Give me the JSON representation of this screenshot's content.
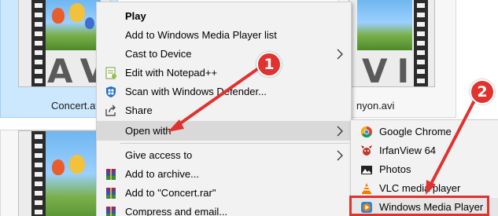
{
  "explorer": {
    "files": [
      {
        "name": "Concert.avi",
        "ext": "AVI"
      },
      {
        "name": "Canyon.avi",
        "name_visible": "nyon.avi",
        "ext": "VI"
      }
    ],
    "lower_tiles": 2
  },
  "context_menu": {
    "items": [
      {
        "label": "Play",
        "bold": true,
        "icon": null
      },
      {
        "label": "Add to Windows Media Player list",
        "icon": null
      },
      {
        "label": "Cast to Device",
        "icon": null,
        "submenu": true
      },
      {
        "label": "Edit with Notepad++",
        "icon": "notepad-plus-plus-icon"
      },
      {
        "label": "Scan with Windows Defender...",
        "icon": "windows-defender-shield-icon"
      },
      {
        "label": "Share",
        "icon": "share-icon"
      },
      {
        "label": "Open with",
        "icon": null,
        "submenu": true,
        "highlighted": true
      },
      {
        "label": "Give access to",
        "icon": null,
        "submenu": true
      },
      {
        "label": "Add to archive...",
        "icon": "winrar-icon"
      },
      {
        "label": "Add to \"Concert.rar\"",
        "icon": "winrar-icon"
      },
      {
        "label": "Compress and email...",
        "icon": "winrar-icon"
      }
    ]
  },
  "open_with_submenu": {
    "items": [
      {
        "label": "Google Chrome",
        "icon": "chrome-icon"
      },
      {
        "label": "IrfanView 64",
        "icon": "irfanview-icon"
      },
      {
        "label": "Photos",
        "icon": "photos-icon"
      },
      {
        "label": "VLC media player",
        "icon": "vlc-icon"
      },
      {
        "label": "Windows Media Player",
        "icon": "windows-media-player-icon",
        "highlighted": true
      }
    ]
  },
  "annotations": {
    "step1": "1",
    "step2": "2"
  },
  "colors": {
    "annotation_red": "#e0322e",
    "menu_bg": "#f2f2f2",
    "menu_hover": "#d9d9d9",
    "selection_blue": "#cce8ff"
  }
}
